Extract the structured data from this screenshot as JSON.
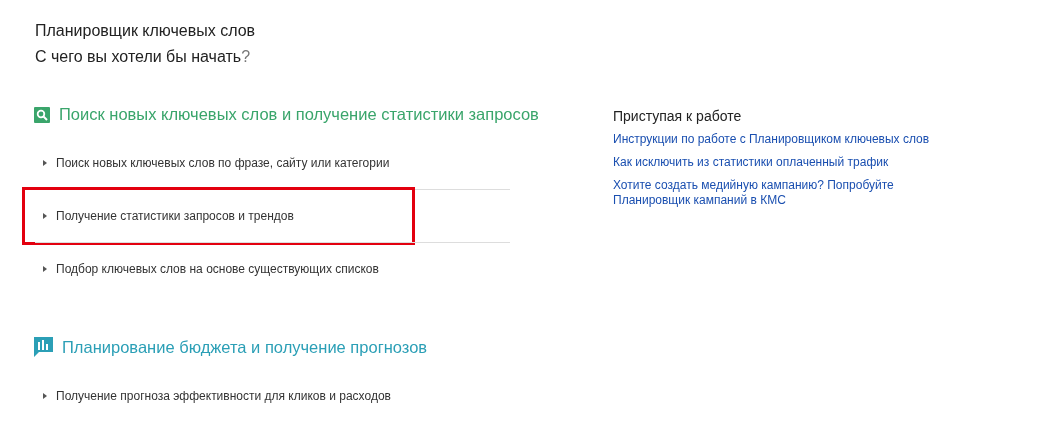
{
  "title": "Планировщик ключевых слов",
  "subtitle": {
    "text": "С чего вы хотели бы начать",
    "mark": "?"
  },
  "sections": [
    {
      "kind": "search",
      "heading": "Поиск новых ключевых слов и получение статистики запросов",
      "items": [
        {
          "label": "Поиск новых ключевых слов по фразе, сайту или категории",
          "highlighted": false
        },
        {
          "label": "Получение статистики запросов и трендов",
          "highlighted": true
        },
        {
          "label": "Подбор ключевых слов на основе существующих списков",
          "highlighted": false
        }
      ]
    },
    {
      "kind": "chart",
      "heading": "Планирование бюджета и получение прогнозов",
      "items": [
        {
          "label": "Получение прогноза эффективности для кликов и расходов",
          "highlighted": false
        }
      ]
    }
  ],
  "sidebar": {
    "heading": "Приступая к работе",
    "links": [
      "Инструкции по работе с Планировщиком ключевых слов",
      "Как исключить из статистики оплаченный трафик",
      "Хотите создать медийную кампанию? Попробуйте Планировщик кампаний в КМС"
    ]
  }
}
